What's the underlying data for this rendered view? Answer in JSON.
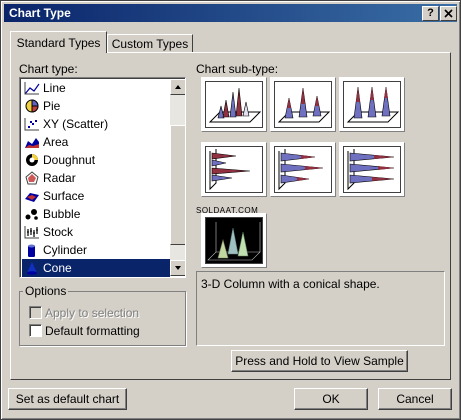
{
  "window": {
    "title": "Chart Type",
    "help_button": "?",
    "close_button": "X"
  },
  "tabs": [
    {
      "label": "Standard Types",
      "selected": true
    },
    {
      "label": "Custom Types",
      "selected": false
    }
  ],
  "chart_type_list": {
    "label": "Chart type:",
    "items": [
      {
        "label": "Line",
        "icon": "line-chart-icon",
        "selected": false
      },
      {
        "label": "Pie",
        "icon": "pie-chart-icon",
        "selected": false
      },
      {
        "label": "XY (Scatter)",
        "icon": "scatter-chart-icon",
        "selected": false
      },
      {
        "label": "Area",
        "icon": "area-chart-icon",
        "selected": false
      },
      {
        "label": "Doughnut",
        "icon": "doughnut-chart-icon",
        "selected": false
      },
      {
        "label": "Radar",
        "icon": "radar-chart-icon",
        "selected": false
      },
      {
        "label": "Surface",
        "icon": "surface-chart-icon",
        "selected": false
      },
      {
        "label": "Bubble",
        "icon": "bubble-chart-icon",
        "selected": false
      },
      {
        "label": "Stock",
        "icon": "stock-chart-icon",
        "selected": false
      },
      {
        "label": "Cylinder",
        "icon": "cylinder-chart-icon",
        "selected": false
      },
      {
        "label": "Cone",
        "icon": "cone-chart-icon",
        "selected": true
      }
    ]
  },
  "chart_subtype": {
    "label": "Chart sub-type:",
    "options": [
      {
        "name": "clustered-cone-column",
        "selected": false
      },
      {
        "name": "stacked-cone-column",
        "selected": false
      },
      {
        "name": "100-stacked-cone-column",
        "selected": false
      },
      {
        "name": "clustered-cone-bar",
        "selected": false
      },
      {
        "name": "stacked-cone-bar",
        "selected": false
      },
      {
        "name": "100-stacked-cone-bar",
        "selected": false
      },
      {
        "name": "3d-cone-column",
        "selected": true
      }
    ],
    "watermark": "SOLDAAT.COM",
    "description": "3-D Column with a conical shape."
  },
  "options": {
    "label": "Options",
    "apply_to_selection": {
      "label": "Apply to selection",
      "checked": false,
      "enabled": false
    },
    "default_formatting": {
      "label": "Default formatting",
      "checked": false,
      "enabled": true
    }
  },
  "buttons": {
    "view_sample": "Press and Hold to View Sample",
    "set_default": "Set as default chart",
    "ok": "OK",
    "cancel": "Cancel"
  },
  "colors": {
    "title_start": "#0a246a",
    "title_end": "#3a6ea5",
    "selection": "#0a246a",
    "face": "#d4d0c8"
  }
}
